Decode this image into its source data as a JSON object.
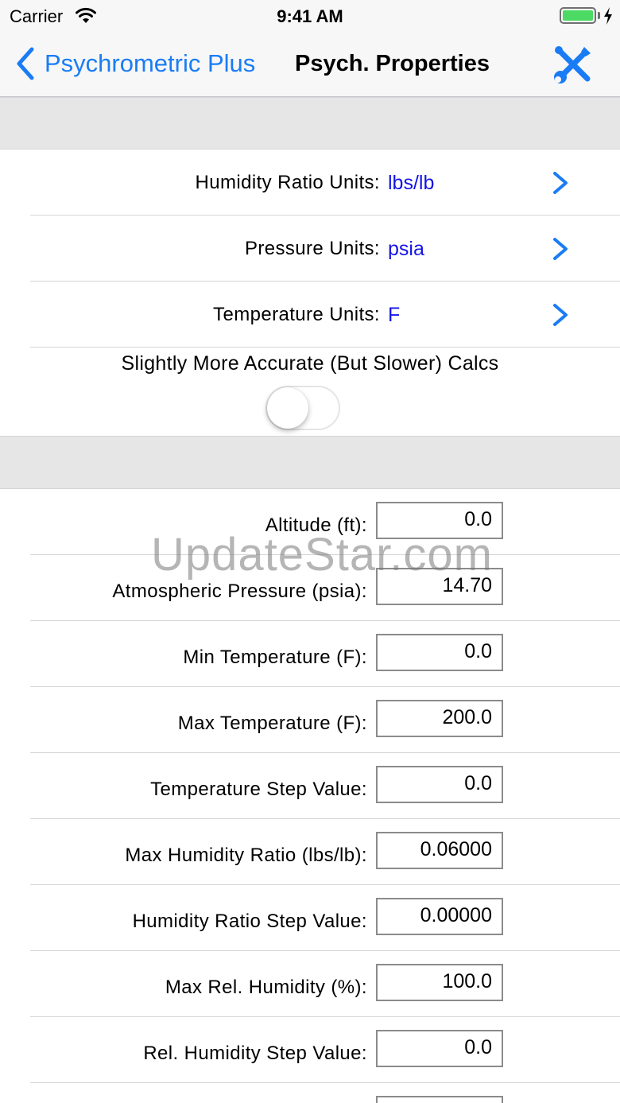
{
  "status_bar": {
    "carrier": "Carrier",
    "time": "9:41 AM",
    "battery_level": 1.0,
    "battery_color": "#4cd964",
    "wifi_icon": "wifi-icon",
    "charging_icon": "bolt-icon"
  },
  "nav": {
    "back_label": "Psychrometric Plus",
    "title": "Psych. Properties",
    "tools_icon": "wrench-screwdriver-icon",
    "accent_color": "#1a7cf5"
  },
  "units": [
    {
      "label": "Humidity Ratio Units:",
      "value": "lbs/lb"
    },
    {
      "label": "Pressure Units:",
      "value": "psia"
    },
    {
      "label": "Temperature Units:",
      "value": "F"
    }
  ],
  "accuracy_toggle": {
    "label": "Slightly More Accurate (But Slower) Calcs",
    "on": false
  },
  "fields": [
    {
      "label": "Altitude (ft):",
      "value": "0.0"
    },
    {
      "label": "Atmospheric Pressure (psia):",
      "value": "14.70"
    },
    {
      "label": "Min Temperature (F):",
      "value": "0.0"
    },
    {
      "label": "Max Temperature (F):",
      "value": "200.0"
    },
    {
      "label": "Temperature Step Value:",
      "value": "0.0"
    },
    {
      "label": "Max Humidity Ratio (lbs/lb):",
      "value": "0.06000"
    },
    {
      "label": "Humidity Ratio Step Value:",
      "value": "0.00000"
    },
    {
      "label": "Max Rel. Humidity (%):",
      "value": "100.0"
    },
    {
      "label": "Rel. Humidity Step Value:",
      "value": "0.0"
    },
    {
      "label": "",
      "value": ""
    }
  ],
  "watermark": "UpdateStar.com"
}
